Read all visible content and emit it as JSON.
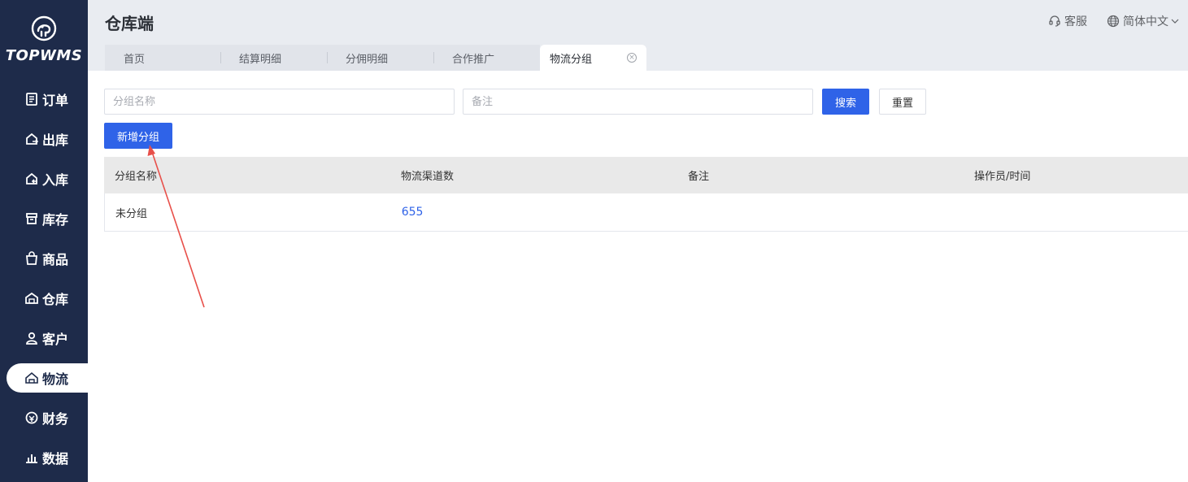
{
  "sidebar": {
    "logo_text": "TOPWMS",
    "items": [
      {
        "label": "订单",
        "icon": "order-list-icon"
      },
      {
        "label": "出库",
        "icon": "outbound-icon"
      },
      {
        "label": "入库",
        "icon": "inbound-icon"
      },
      {
        "label": "库存",
        "icon": "inventory-box-icon"
      },
      {
        "label": "商品",
        "icon": "product-bag-icon"
      },
      {
        "label": "仓库",
        "icon": "warehouse-icon"
      },
      {
        "label": "客户",
        "icon": "customer-user-icon"
      },
      {
        "label": "物流",
        "icon": "logistics-icon",
        "active": true
      },
      {
        "label": "财务",
        "icon": "finance-icon"
      },
      {
        "label": "数据",
        "icon": "data-chart-icon"
      }
    ]
  },
  "header": {
    "title": "仓库端",
    "support_label": "客服",
    "language_label": "简体中文"
  },
  "tabs": [
    {
      "label": "首页"
    },
    {
      "label": "结算明细"
    },
    {
      "label": "分佣明细"
    },
    {
      "label": "合作推广"
    },
    {
      "label": "物流分组",
      "active": true
    }
  ],
  "filters": {
    "group_name_placeholder": "分组名称",
    "note_placeholder": "备注",
    "search_label": "搜索",
    "reset_label": "重置"
  },
  "actions": {
    "add_group_label": "新增分组"
  },
  "table": {
    "columns": [
      "分组名称",
      "物流渠道数",
      "备注",
      "操作员/时间"
    ],
    "rows": [
      {
        "group_name": "未分组",
        "channel_count": "655",
        "note": "",
        "operator_time": ""
      }
    ]
  },
  "colors": {
    "sidebar_bg": "#1e2b4a",
    "primary": "#2f63e8",
    "annotation_arrow": "#e8504a"
  }
}
